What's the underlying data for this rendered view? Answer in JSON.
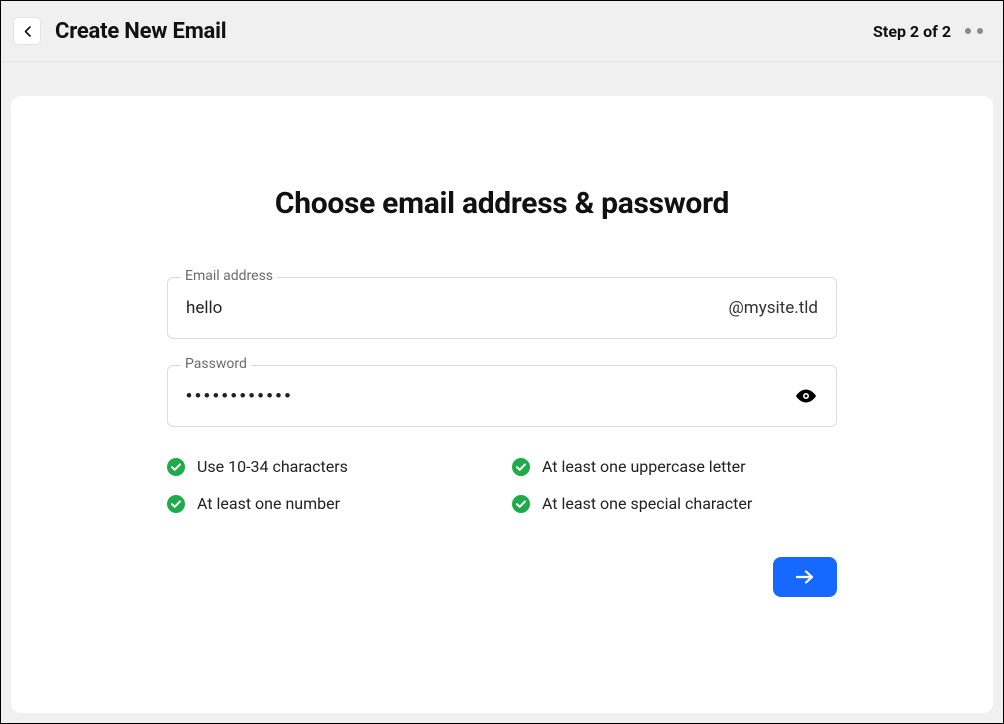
{
  "header": {
    "title": "Create New Email",
    "step_text": "Step 2 of 2"
  },
  "card": {
    "title": "Choose email address & password"
  },
  "email": {
    "label": "Email address",
    "value": "hello",
    "domain": "@mysite.tld"
  },
  "password": {
    "label": "Password",
    "value": "••••••••••••"
  },
  "rules": {
    "r1": "Use 10-34 characters",
    "r2": "At least one uppercase letter",
    "r3": "At least one number",
    "r4": "At least one special character"
  }
}
